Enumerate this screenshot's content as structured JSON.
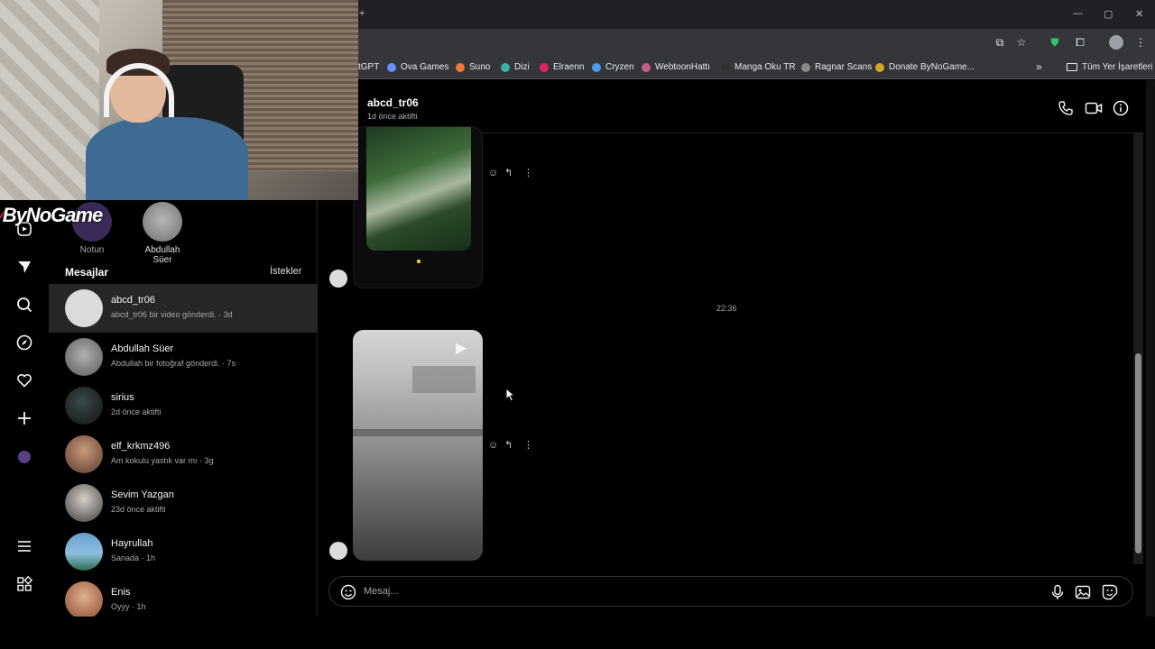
{
  "browser": {
    "window_controls": [
      "—",
      "▢",
      "✕"
    ],
    "bookmarks": [
      {
        "label": "tGPT",
        "color": "#74aa9c"
      },
      {
        "label": "Ova Games",
        "color": "#6b8cff"
      },
      {
        "label": "Suno",
        "color": "#f07a3a"
      },
      {
        "label": "Dizi",
        "color": "#3ab0a8"
      },
      {
        "label": "Elraenn",
        "color": "#e0245e"
      },
      {
        "label": "Cryzen",
        "color": "#4a9bef"
      },
      {
        "label": "WebtoonHattı",
        "color": "#c45c8a"
      },
      {
        "label": "Manga Oku TR",
        "color": "#2f2f2f"
      },
      {
        "label": "Ragnar Scans",
        "color": "#888888"
      },
      {
        "label": "Donate ByNoGame...",
        "color": "#d9a520"
      }
    ],
    "overflow": "»",
    "all_bookmarks": "Tüm Yer İşaretleri"
  },
  "overlay": {
    "logo": "ByNoGame"
  },
  "stories": [
    {
      "label": "Notun"
    },
    {
      "label": "Abdullah Süer"
    }
  ],
  "inbox": {
    "title": "Mesajlar",
    "requests": "İstekler",
    "conversations": [
      {
        "name": "abcd_tr06",
        "subtitle": "abcd_tr06 bir video gönderdi. · 3d",
        "active": true
      },
      {
        "name": "Abdullah Süer",
        "subtitle": "Abdullah bir fotoğraf gönderdi. · 7s"
      },
      {
        "name": "sirius",
        "subtitle": "2d önce aktifti"
      },
      {
        "name": "elf_krkmz496",
        "subtitle": "Am kokulu yastık var mı · 3g"
      },
      {
        "name": "Sevim Yazgan",
        "subtitle": "23d önce aktifti"
      },
      {
        "name": "Hayrullah",
        "subtitle": "Sanada · 1h"
      },
      {
        "name": "Enis",
        "subtitle": "Oyyy · 1h"
      }
    ]
  },
  "chat": {
    "name": "abcd_tr06",
    "status": "1d önce aktifti",
    "time_separator": "22:36",
    "composer_placeholder": "Mesaj..."
  },
  "colors": {
    "background": "#000000",
    "active_row": "#262626",
    "secondary_text": "#a8a8a8"
  }
}
